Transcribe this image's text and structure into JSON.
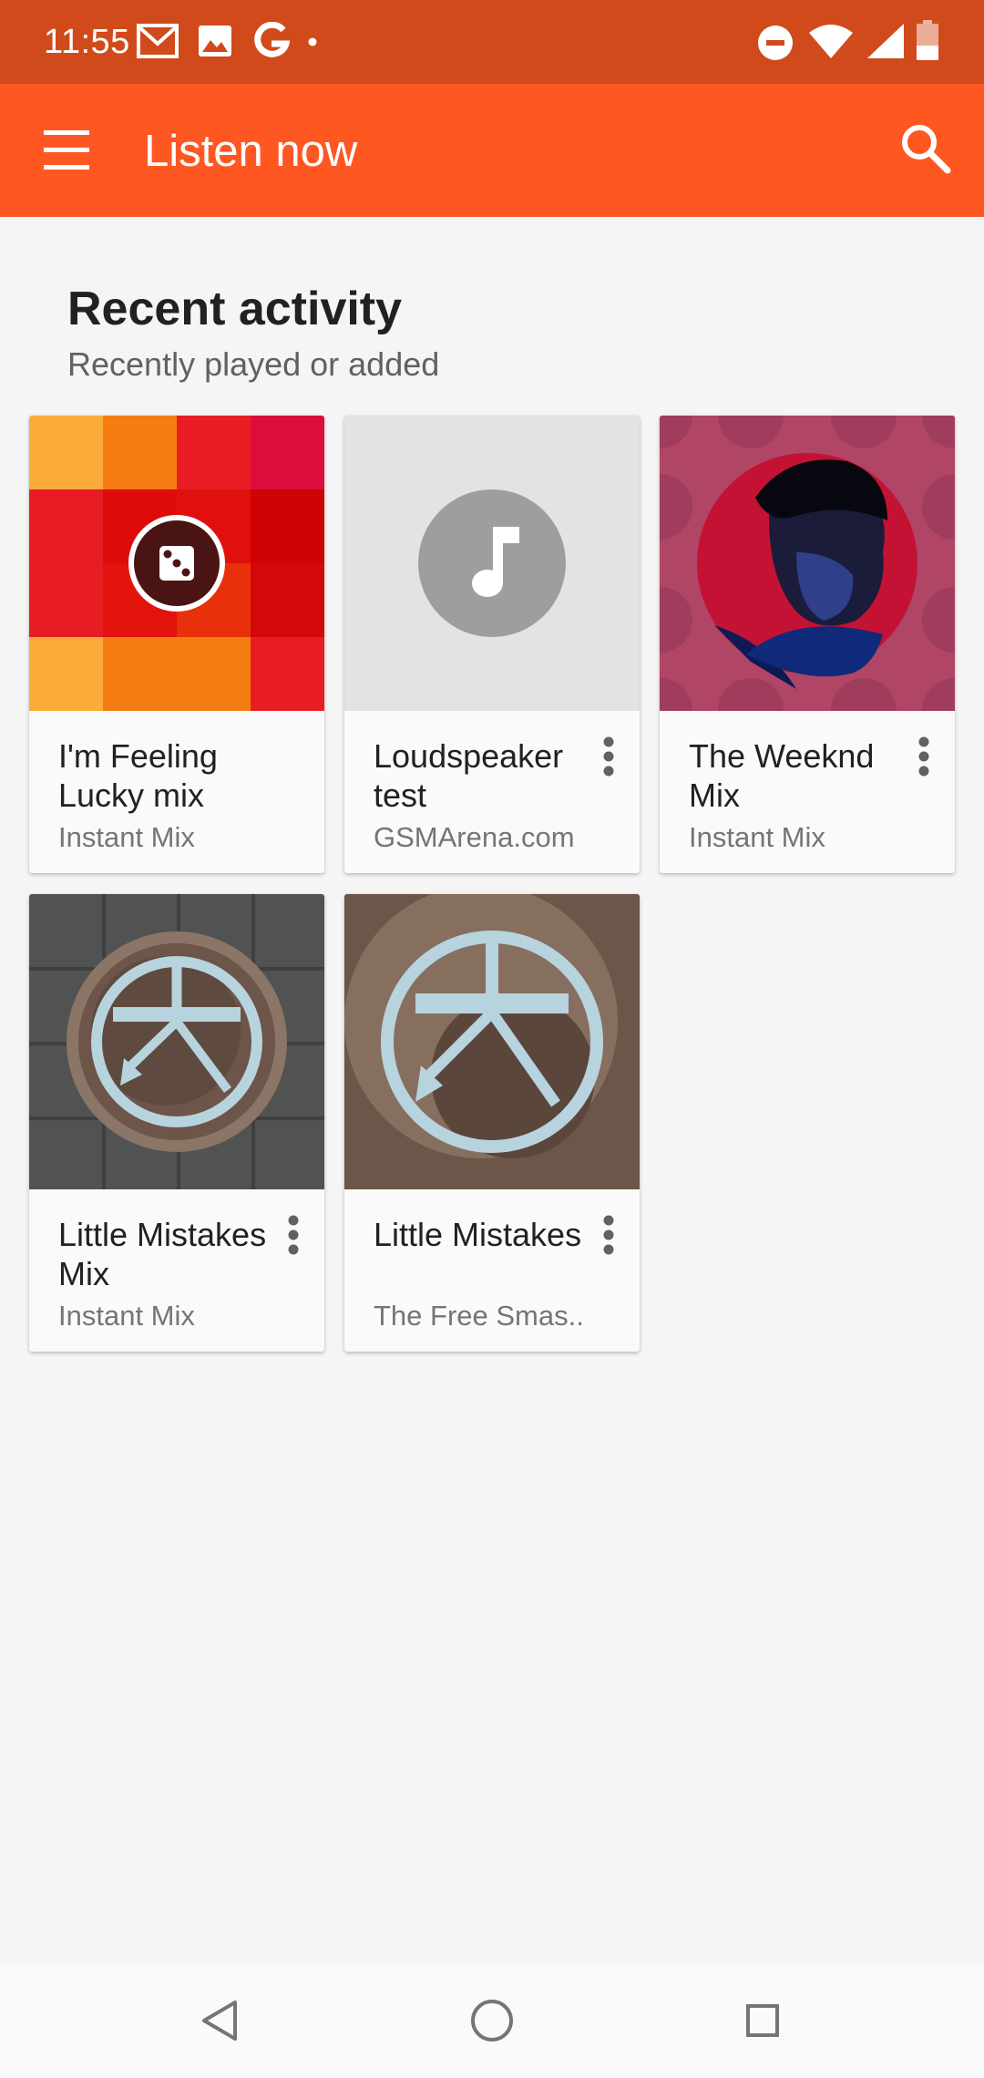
{
  "status_bar": {
    "time": "11:55",
    "icons": [
      "gmail-icon",
      "image-icon",
      "google-icon",
      "notification-dot-icon",
      "do-not-disturb-icon",
      "wifi-icon",
      "signal-icon",
      "battery-icon"
    ]
  },
  "app_bar": {
    "title": "Listen now",
    "menu_icon": "hamburger-menu-icon",
    "search_icon": "search-icon",
    "color": "#ff5722"
  },
  "section": {
    "title": "Recent activity",
    "subtitle": "Recently played or added"
  },
  "cards": [
    {
      "title": "I'm Feeling Lucky mix",
      "subtitle": "Instant Mix",
      "art": "dice-mosaic",
      "has_menu": false
    },
    {
      "title": "Loudspeaker test",
      "subtitle": "GSMArena.com",
      "art": "music-note",
      "has_menu": true
    },
    {
      "title": "The Weeknd Mix",
      "subtitle": "Instant Mix",
      "art": "artist-portrait",
      "has_menu": true
    },
    {
      "title": "Little Mistakes Mix",
      "subtitle": "Instant Mix",
      "art": "album-cover-circle",
      "has_menu": true
    },
    {
      "title": "Little Mistakes",
      "subtitle": "The Free Smas..",
      "art": "album-cover",
      "has_menu": true
    }
  ],
  "nav_bar": {
    "back_icon": "back-triangle-icon",
    "home_icon": "home-circle-icon",
    "recents_icon": "recents-square-icon"
  },
  "colors": {
    "status_bar": "#d14a1b",
    "accent": "#ff5722",
    "background": "#f5f5f5"
  }
}
